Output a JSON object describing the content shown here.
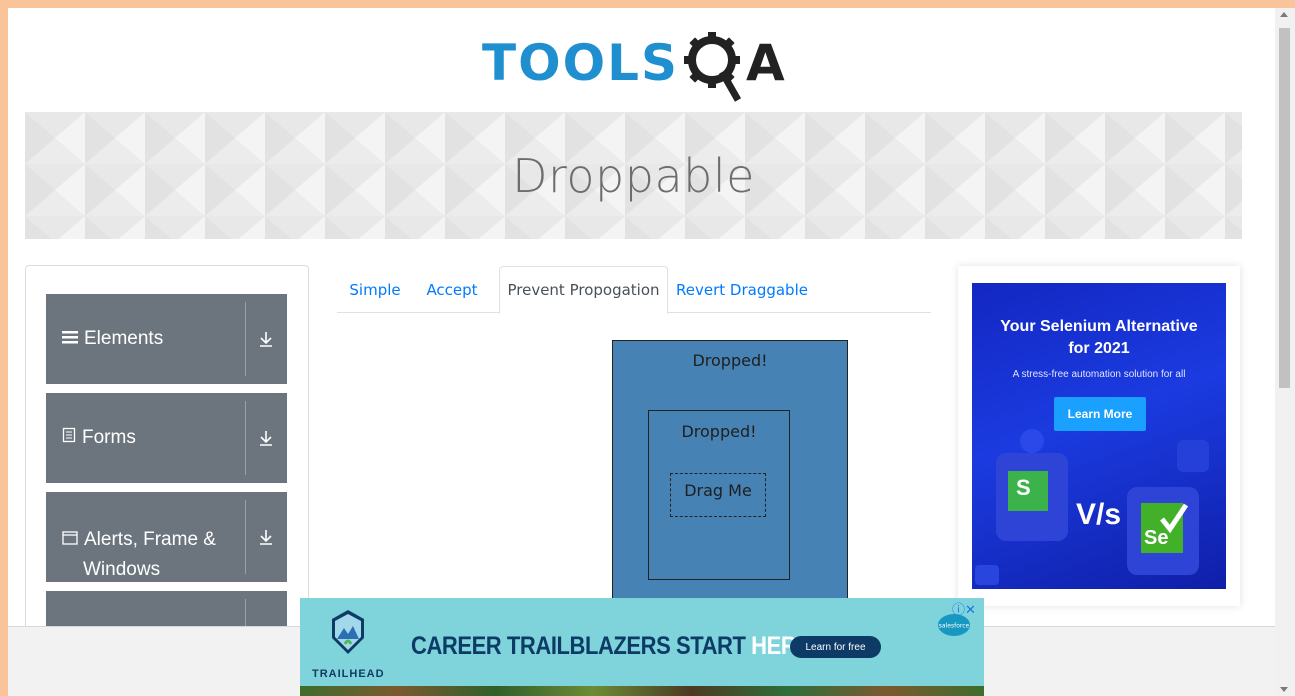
{
  "logo": {
    "text_left": "TOOLS",
    "text_right": "A"
  },
  "banner": {
    "title": "Droppable"
  },
  "sidebar": {
    "groups": [
      {
        "label": "Elements",
        "icon": "hamburger-icon"
      },
      {
        "label": "Forms",
        "icon": "document-icon"
      },
      {
        "label_line1": "Alerts, Frame &",
        "label_line2": "Windows",
        "icon": "window-icon"
      },
      {
        "label": "",
        "icon": ""
      }
    ]
  },
  "tabs": [
    {
      "label": "Simple"
    },
    {
      "label": "Accept"
    },
    {
      "label": "Prevent Propogation"
    },
    {
      "label": "Revert Draggable"
    }
  ],
  "droppable": {
    "outer_text": "Dropped!",
    "inner_text": "Dropped!",
    "drag_text": "Drag Me"
  },
  "side_ad": {
    "headline_line1": "Your Selenium Alternative",
    "headline_line2": "for 2021",
    "subtext": "A stress-free automation solution for all",
    "cta": "Learn More",
    "vs": "V/s",
    "brand_left": "S",
    "brand_right": "Se"
  },
  "bottom_ad": {
    "brand": "TRAILHEAD",
    "slogan_main": "CAREER TRAILBLAZERS START ",
    "slogan_highlight": "HERE.",
    "cta": "Learn for free",
    "partner": "salesforce",
    "colors": {
      "background": "#7fd4dc",
      "text": "#0d3b66"
    }
  },
  "colors": {
    "menu_group_bg": "#6c757d",
    "droppable_bg": "#4682b4",
    "tab_link": "#007bff",
    "frame": "#f9c49a"
  }
}
